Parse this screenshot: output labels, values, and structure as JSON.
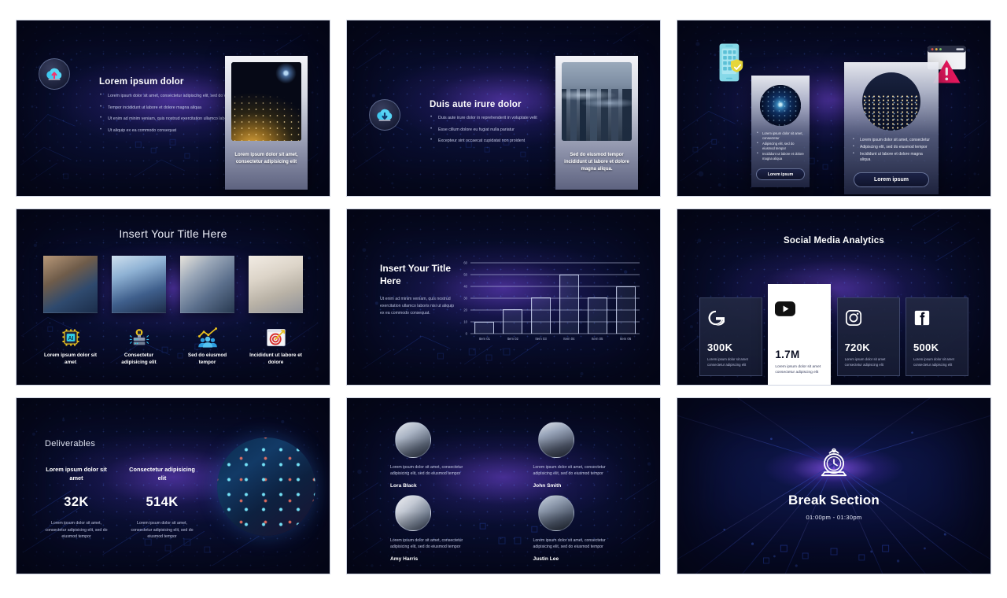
{
  "slides": [
    {
      "id": "slide-cloud-upload",
      "heading": "Lorem ipsum dolor",
      "icon": "cloud-upload-icon",
      "bullets": [
        "Lorem ipsum dolor sit amet, consectetur adipiscing elit, sed do eiusmod",
        "Tempor incididunt ut labore et dolore magna aliqua",
        "Ut enim ad minim veniam, quis nostrud exercitation ullamco laboris nisi",
        "Ut aliquip ex ea commodo consequat"
      ],
      "card": {
        "image": "earth-network-night-image",
        "caption": "Lorem ipsum dolor sit amet, consectetur adipisicing elit"
      }
    },
    {
      "id": "slide-cloud-download",
      "heading": "Duis aute irure dolor",
      "icon": "cloud-download-icon",
      "bullets": [
        "Duis aute irure dolor in reprehenderit  in voluptate velit",
        "Esse cillum dolore eu fugiat nulla pariatur",
        "Excepteur sint occaecat cupidatat non proident"
      ],
      "card": {
        "image": "city-network-image",
        "caption": "Sed do eiusmod tempor incididunt ut labore et dolore magna aliqua."
      }
    },
    {
      "id": "slide-two-cards",
      "decorations": [
        "phone-shield-icon",
        "browser-warning-icon"
      ],
      "cards": [
        {
          "image": "nebula-circle-image",
          "bullets": [
            "Lorem ipsum dolor sit amet, consectetur",
            "Adipiscing elit, sed do eiusmod tempor",
            "Incididunt ut labore et dolore magna aliqua"
          ],
          "button": "Lorem ipsum"
        },
        {
          "image": "night-city-circle-image",
          "bullets": [
            "Lorem ipsum dolor sit amet, consectetur",
            "Adipiscing elit, sed do eiusmod tempor",
            "Incididunt ut labore et dolore magna aliqua"
          ],
          "button": "Lorem ipsum"
        }
      ]
    },
    {
      "id": "slide-gallery",
      "title": "Insert Your Title Here",
      "images": [
        "welding-hud-image",
        "tablet-data-image",
        "factory-arm-image",
        "laptop-dashboard-image"
      ],
      "features": [
        {
          "icon": "ai-chip-icon",
          "label": "Lorem ipsum dolor sit amet"
        },
        {
          "icon": "server-rack-icon",
          "label": "Consectetur adipisicing elit"
        },
        {
          "icon": "growth-people-icon",
          "label": "Sed do eiusmod tempor"
        },
        {
          "icon": "target-dart-icon",
          "label": "Incididunt ut labore et dolore"
        }
      ]
    },
    {
      "id": "slide-chart",
      "title": "Insert Your Title Here",
      "description": "Ut enim ad minim veniam, quis nostrud exercitation ullamco laboris nisi ut aliquip ex ea commodo consequat."
    },
    {
      "id": "slide-social",
      "title": "Social Media Analytics",
      "cards": [
        {
          "icon": "google-icon",
          "value": "300K",
          "text": "Lorem ipsum dolor sit amet consectetur adipiscing elit",
          "featured": false
        },
        {
          "icon": "youtube-icon",
          "value": "1.7M",
          "text": "Lorem ipsum dolor sit amet consectetur adipiscing elit",
          "featured": true
        },
        {
          "icon": "instagram-icon",
          "value": "720K",
          "text": "Lorem ipsum dolor sit amet consectetur adipiscing elit",
          "featured": false
        },
        {
          "icon": "facebook-icon",
          "value": "500K",
          "text": "Lorem ipsum dolor sit amet consectetur adipiscing elit",
          "featured": false
        }
      ]
    },
    {
      "id": "slide-deliverables",
      "title": "Deliverables",
      "columns": [
        {
          "heading": "Lorem ipsum dolor sit amet",
          "number": "32K",
          "text": "Lorem ipsum dolor sit amet, consectetur adipisicing elit, sed do eiusmod tempor"
        },
        {
          "heading": "Consectetur adipisicing elit",
          "number": "514K",
          "text": "Lorem ipsum dolor sit amet, consectetur adipisicing elit, sed do eiusmod tempor"
        }
      ],
      "image": "data-server-circle-image"
    },
    {
      "id": "slide-team",
      "members": [
        {
          "avatar": "team-avatar-1",
          "text": "Lorem ipsum dolor sit amet, consectetur adipisicing elit, sed do eiusmod tempor",
          "name": "Lora Black"
        },
        {
          "avatar": "team-avatar-2",
          "text": "Lorem ipsum dolor sit amet, consectetur adipisicing elit, sed do eiusmod tempor",
          "name": "John Smith"
        },
        {
          "avatar": "team-avatar-3",
          "text": "Lorem ipsum dolor sit amet, consectetur adipisicing elit, sed do eiusmod tempor",
          "name": "Amy Harris"
        },
        {
          "avatar": "team-avatar-4",
          "text": "Lorem ipsum dolor sit amet, consectetur adipisicing elit, sed do eiusmod tempor",
          "name": "Justin Lee"
        }
      ]
    },
    {
      "id": "slide-break",
      "icon": "alarm-clock-icon",
      "title": "Break Section",
      "time": "01:00pm - 01:30pm"
    }
  ],
  "chart_data": {
    "type": "bar",
    "title": "Insert Your Title Here",
    "categories": [
      "Item 01",
      "Item 02",
      "Item 03",
      "Item 04",
      "Item 05",
      "Item 06"
    ],
    "values": [
      10,
      21,
      31,
      50,
      31,
      40
    ],
    "yticks": [
      0,
      10,
      20,
      30,
      40,
      50,
      60
    ],
    "ylim": [
      0,
      60
    ],
    "xlabel": "",
    "ylabel": "",
    "grid": true,
    "legend": false
  },
  "colors": {
    "background": "#ffffff",
    "slide_dark": "#070b22",
    "accent_purple": "#7d46dc",
    "accent_blue": "#3b6fd4",
    "text_light": "#ffffff",
    "text_muted": "#c0c6e2",
    "warning_pink": "#e8185f",
    "shield_yellow": "#e8d838",
    "phone_teal": "#86d9e8"
  }
}
